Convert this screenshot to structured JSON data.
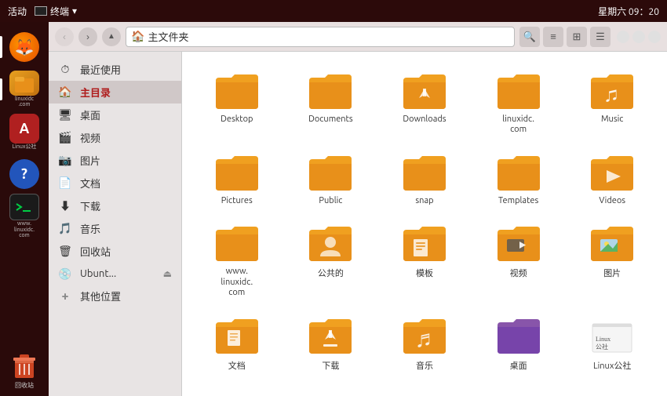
{
  "topbar": {
    "activities": "活动",
    "terminal": "终端",
    "dropdown": "▾",
    "time": "星期六 09：20"
  },
  "launcher": {
    "items": [
      {
        "name": "firefox",
        "label": "",
        "icon": "firefox"
      },
      {
        "name": "files",
        "label": "linuxidc\n.com",
        "icon": "files",
        "active": true
      },
      {
        "name": "font",
        "label": "Linux公社",
        "icon": "font"
      },
      {
        "name": "help",
        "label": "",
        "icon": "help"
      },
      {
        "name": "terminal",
        "label": "www.\nlinuxidc.\ncom",
        "icon": "terminal"
      },
      {
        "name": "trash",
        "label": "回收站",
        "icon": "trash"
      }
    ]
  },
  "titlebar": {
    "back": "‹",
    "forward": "›",
    "up": "↑",
    "location": "主文件夹",
    "search_icon": "🔍",
    "view_list": "☰",
    "view_grid": "⊞",
    "menu_icon": "≡",
    "win_min": "−",
    "win_max": "□",
    "win_close": "×"
  },
  "sidebar": {
    "items": [
      {
        "id": "recent",
        "icon": "⏱",
        "label": "最近使用"
      },
      {
        "id": "home",
        "icon": "🏠",
        "label": "主目录",
        "active": true
      },
      {
        "id": "desktop",
        "icon": "🖥",
        "label": "桌面"
      },
      {
        "id": "videos",
        "icon": "🎬",
        "label": "视频"
      },
      {
        "id": "pictures",
        "icon": "📷",
        "label": "图片"
      },
      {
        "id": "documents",
        "icon": "📄",
        "label": "文档"
      },
      {
        "id": "downloads",
        "icon": "⬇",
        "label": "下载"
      },
      {
        "id": "music",
        "icon": "🎵",
        "label": "音乐"
      },
      {
        "id": "trash",
        "icon": "🗑",
        "label": "回收站"
      },
      {
        "id": "ubuntu",
        "icon": "💿",
        "label": "Ubunt...",
        "eject": true
      },
      {
        "id": "other",
        "icon": "+",
        "label": "其他位置"
      }
    ]
  },
  "files": [
    {
      "name": "Desktop",
      "type": "folder"
    },
    {
      "name": "Documents",
      "type": "folder"
    },
    {
      "name": "Downloads",
      "type": "folder-download"
    },
    {
      "name": "linuxidc.\ncom",
      "type": "folder"
    },
    {
      "name": "Music",
      "type": "folder-music"
    },
    {
      "name": "Pictures",
      "type": "folder"
    },
    {
      "name": "Public",
      "type": "folder"
    },
    {
      "name": "snap",
      "type": "folder"
    },
    {
      "name": "Templates",
      "type": "folder"
    },
    {
      "name": "Videos",
      "type": "folder-film"
    },
    {
      "name": "www.\nlinuxidc.\ncom",
      "type": "folder"
    },
    {
      "name": "公共的",
      "type": "folder-person"
    },
    {
      "name": "模板",
      "type": "folder-template"
    },
    {
      "name": "视频",
      "type": "folder-video"
    },
    {
      "name": "图片",
      "type": "folder-picture"
    },
    {
      "name": "文档",
      "type": "folder-doc"
    },
    {
      "name": "下载",
      "type": "folder-down2"
    },
    {
      "name": "音乐",
      "type": "folder-music2"
    },
    {
      "name": "桌面",
      "type": "folder-desktop"
    },
    {
      "name": "Linux公社",
      "type": "folder-linuxidc"
    }
  ]
}
